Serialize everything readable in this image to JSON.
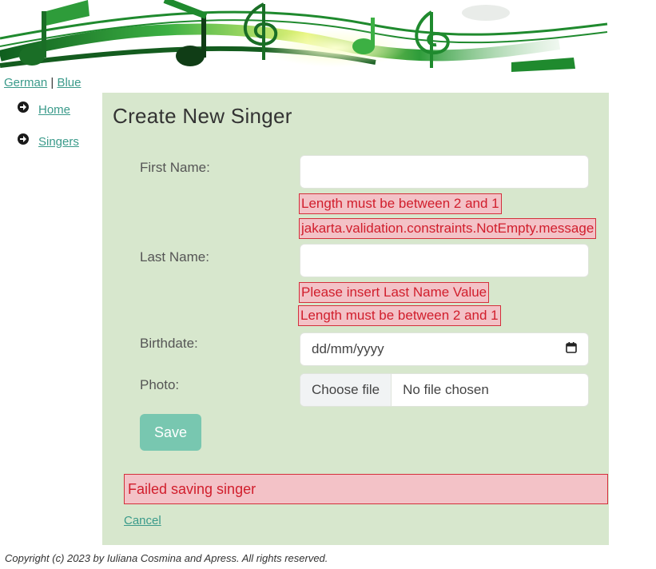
{
  "header": {
    "links": [
      {
        "label": "German"
      },
      {
        "label": "Blue"
      }
    ],
    "separator": "|"
  },
  "menu": {
    "items": [
      {
        "label": "Home",
        "icon": "arrow-circle-right-icon"
      },
      {
        "label": "Singers",
        "icon": "arrow-circle-right-icon"
      }
    ]
  },
  "form": {
    "title": "Create New Singer",
    "first_name": {
      "label": "First Name:",
      "value": "",
      "errors": [
        "Length must be between 2 and 1",
        "jakarta.validation.constraints.NotEmpty.message"
      ]
    },
    "last_name": {
      "label": "Last Name:",
      "value": "",
      "errors": [
        "Please insert Last Name Value",
        "Length must be between 2 and 1"
      ]
    },
    "birthdate": {
      "label": "Birthdate:",
      "placeholder": "dd/mm/yyyy",
      "icon": "calendar-icon"
    },
    "photo": {
      "label": "Photo:",
      "button_label": "Choose file",
      "status": "No file chosen"
    },
    "save_label": "Save",
    "global_error": "Failed saving singer",
    "cancel_label": "Cancel"
  },
  "footer": {
    "copyright": "Copyright (c) 2023 by Iuliana Cosmina and Apress. All rights reserved."
  },
  "colors": {
    "panel_bg": "#d7e7cd",
    "link": "#3a9a8a",
    "error_text": "#d11e2c",
    "error_bg": "#f3c2c7",
    "save_button": "#78c7b0",
    "banner_green": "#1f8a2e"
  }
}
